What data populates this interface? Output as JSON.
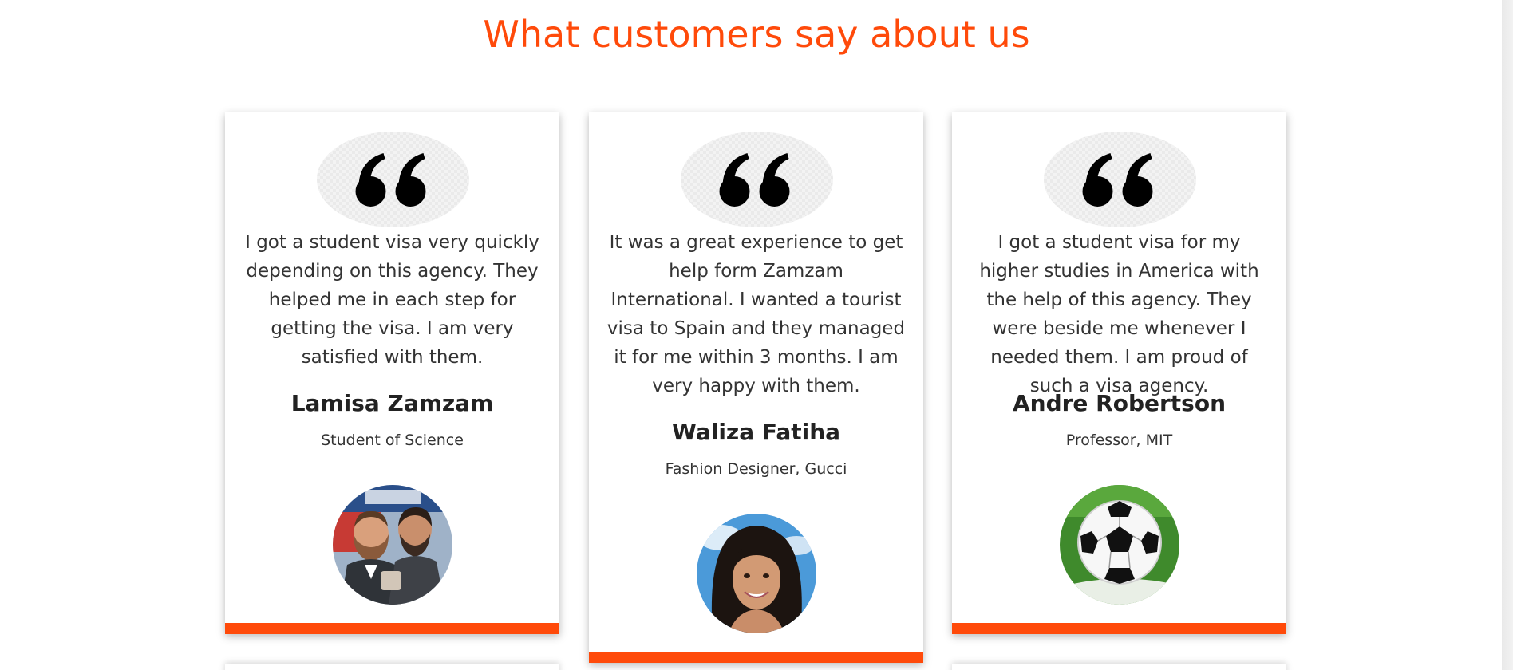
{
  "section": {
    "title": "What customers say about us"
  },
  "colors": {
    "accent": "#ff4a0a",
    "text": "#333333",
    "card_background": "#ffffff"
  },
  "testimonials": [
    {
      "quote_icon": "double-quote-icon",
      "text": "I got a student visa very quickly depending on this agency. They helped me in each step for getting the visa. I am very satisfied with them.",
      "name": "Lamisa Zamzam",
      "role": "Student of Science",
      "avatar": "two-men-photo"
    },
    {
      "quote_icon": "double-quote-icon",
      "text": "It was a great experience to get help form Zamzam International. I wanted a tourist visa to Spain and they managed it for me within 3 months. I am very happy with them.",
      "name": "Waliza Fatiha",
      "role": "Fashion Designer, Gucci",
      "avatar": "smiling-woman-photo"
    },
    {
      "quote_icon": "double-quote-icon",
      "text": "I got a student visa for my higher studies in America with the help of this agency. They were beside me whenever I needed them. I am proud of such a visa agency.",
      "name": "Andre Robertson",
      "role": "Professor, MIT",
      "avatar": "soccer-ball-photo"
    }
  ]
}
